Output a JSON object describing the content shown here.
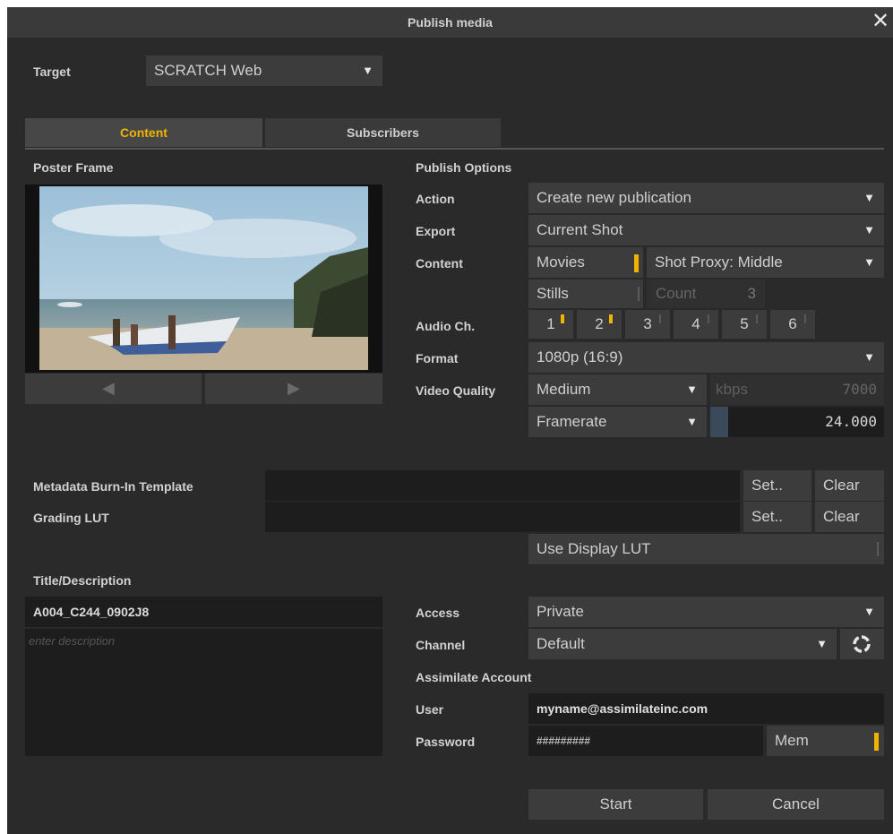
{
  "window": {
    "title": "Publish media",
    "close_icon": "close-icon"
  },
  "target": {
    "label": "Target",
    "value": "SCRATCH Web"
  },
  "tabs": [
    {
      "label": "Content",
      "active": true
    },
    {
      "label": "Subscribers",
      "active": false
    }
  ],
  "poster": {
    "label": "Poster Frame",
    "prev_icon": "arrow-left-icon",
    "next_icon": "arrow-right-icon"
  },
  "options": {
    "heading": "Publish Options",
    "action": {
      "label": "Action",
      "value": "Create new publication"
    },
    "export": {
      "label": "Export",
      "value": "Current Shot"
    },
    "content": {
      "label": "Content",
      "movies": "Movies",
      "proxy": "Shot Proxy: Middle",
      "stills": "Stills",
      "count_label": "Count",
      "count_value": "3"
    },
    "audio": {
      "label": "Audio Ch.",
      "channels": [
        "1",
        "2",
        "3",
        "4",
        "5",
        "6"
      ]
    },
    "format": {
      "label": "Format",
      "value": "1080p (16:9)"
    },
    "quality": {
      "label": "Video Quality",
      "value": "Medium",
      "kbps_label": "kbps",
      "kbps_value": "7000",
      "framerate_label": "Framerate",
      "framerate_value": "24.000"
    }
  },
  "metadata": {
    "label": "Metadata Burn-In Template",
    "set": "Set..",
    "clear": "Clear"
  },
  "lut": {
    "label": "Grading LUT",
    "set": "Set..",
    "clear": "Clear",
    "display": "Use Display LUT"
  },
  "title_desc": {
    "label": "Title/Description",
    "title_value": "A004_C244_0902J8",
    "desc_placeholder": "enter description"
  },
  "access": {
    "label": "Access",
    "value": "Private"
  },
  "channel": {
    "label": "Channel",
    "value": "Default",
    "refresh_icon": "refresh-icon"
  },
  "account": {
    "heading": "Assimilate Account",
    "user_label": "User",
    "user_value": "myname@assimilateinc.com",
    "password_label": "Password",
    "password_value": "#########",
    "mem": "Mem"
  },
  "buttons": {
    "start": "Start",
    "cancel": "Cancel"
  },
  "colors": {
    "accent": "#f0b400",
    "bg": "#2a2a2a",
    "field": "#3c3c3c",
    "dark": "#1d1d1d"
  }
}
